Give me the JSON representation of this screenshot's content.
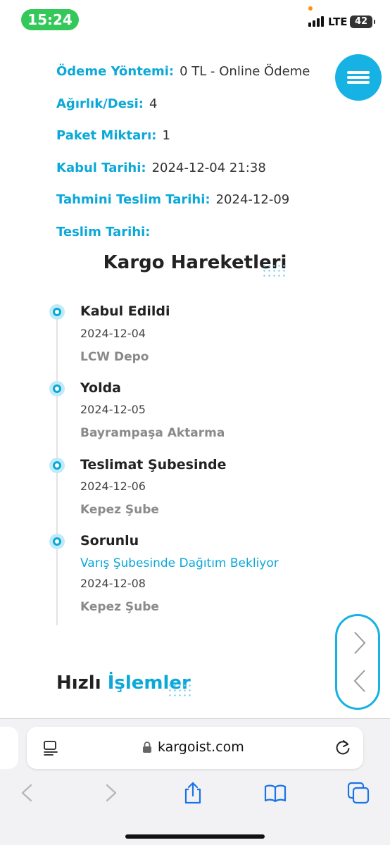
{
  "status_bar": {
    "time": "15:24",
    "network": "LTE",
    "battery": "42"
  },
  "shipment_info": [
    {
      "label": "Ödeme Yöntemi:",
      "value": "0 TL - Online Ödeme"
    },
    {
      "label": "Ağırlık/Desi:",
      "value": "4"
    },
    {
      "label": "Paket Miktarı:",
      "value": "1"
    },
    {
      "label": "Kabul Tarihi:",
      "value": "2024-12-04 21:38"
    },
    {
      "label": "Tahmini Teslim Tarihi:",
      "value": "2024-12-09"
    },
    {
      "label": "Teslim Tarihi:",
      "value": ""
    }
  ],
  "movements": {
    "title": "Kargo Hareketleri",
    "events": [
      {
        "status": "Kabul Edildi",
        "note": "",
        "date": "2024-12-04",
        "location": "LCW Depo"
      },
      {
        "status": "Yolda",
        "note": "",
        "date": "2024-12-05",
        "location": "Bayrampaşa Aktarma"
      },
      {
        "status": "Teslimat Şubesinde",
        "note": "",
        "date": "2024-12-06",
        "location": "Kepez Şube"
      },
      {
        "status": "Sorunlu",
        "note": "Varış Şubesinde Dağıtım Bekliyor",
        "date": "2024-12-08",
        "location": "Kepez Şube"
      }
    ]
  },
  "quick_actions": {
    "title_part1": "Hızlı",
    "title_part2": "İşlemler"
  },
  "browser": {
    "url": "kargoist.com"
  },
  "colors": {
    "accent": "#0ba8d8",
    "menu_button": "#16b2e3",
    "time_pill": "#34c759"
  },
  "icons": {
    "menu": "hamburger-icon",
    "next": "chevron-right-icon",
    "prev": "chevron-left-icon",
    "lock": "lock-icon",
    "reader": "reader-icon",
    "reload": "reload-icon",
    "back": "back-icon",
    "forward": "forward-icon",
    "share": "share-icon",
    "bookmarks": "book-icon",
    "tabs": "tabs-icon"
  }
}
